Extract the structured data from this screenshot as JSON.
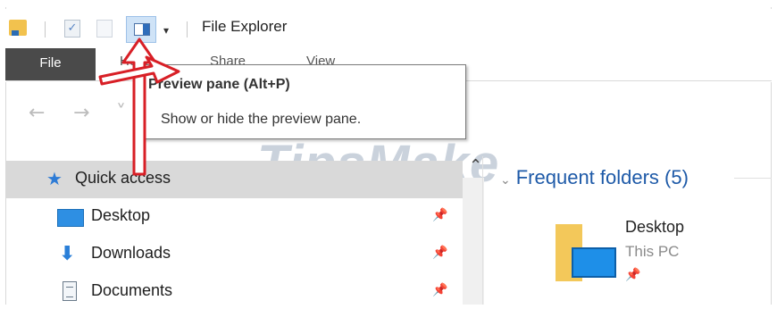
{
  "titlebar": {
    "title": "File Explorer",
    "dropdown_glyph": "▾"
  },
  "ribbon": {
    "tabs": [
      "File",
      "Home",
      "Share",
      "View"
    ]
  },
  "tooltip": {
    "title": "Preview pane (Alt+P)",
    "description": "Show or hide the preview pane."
  },
  "watermark": "TipsMake",
  "navpane": {
    "items": [
      {
        "label": "Quick access",
        "icon": "star-icon"
      },
      {
        "label": "Desktop",
        "icon": "desktop-icon"
      },
      {
        "label": "Downloads",
        "icon": "download-icon"
      },
      {
        "label": "Documents",
        "icon": "documents-icon"
      }
    ]
  },
  "content": {
    "group_header": "Frequent folders (5)",
    "folders": [
      {
        "name": "Desktop",
        "location": "This PC"
      }
    ]
  },
  "colors": {
    "file_tab": "#4a4a4a",
    "accent_blue": "#1e5aa8",
    "annotation_red": "#d81f26"
  }
}
